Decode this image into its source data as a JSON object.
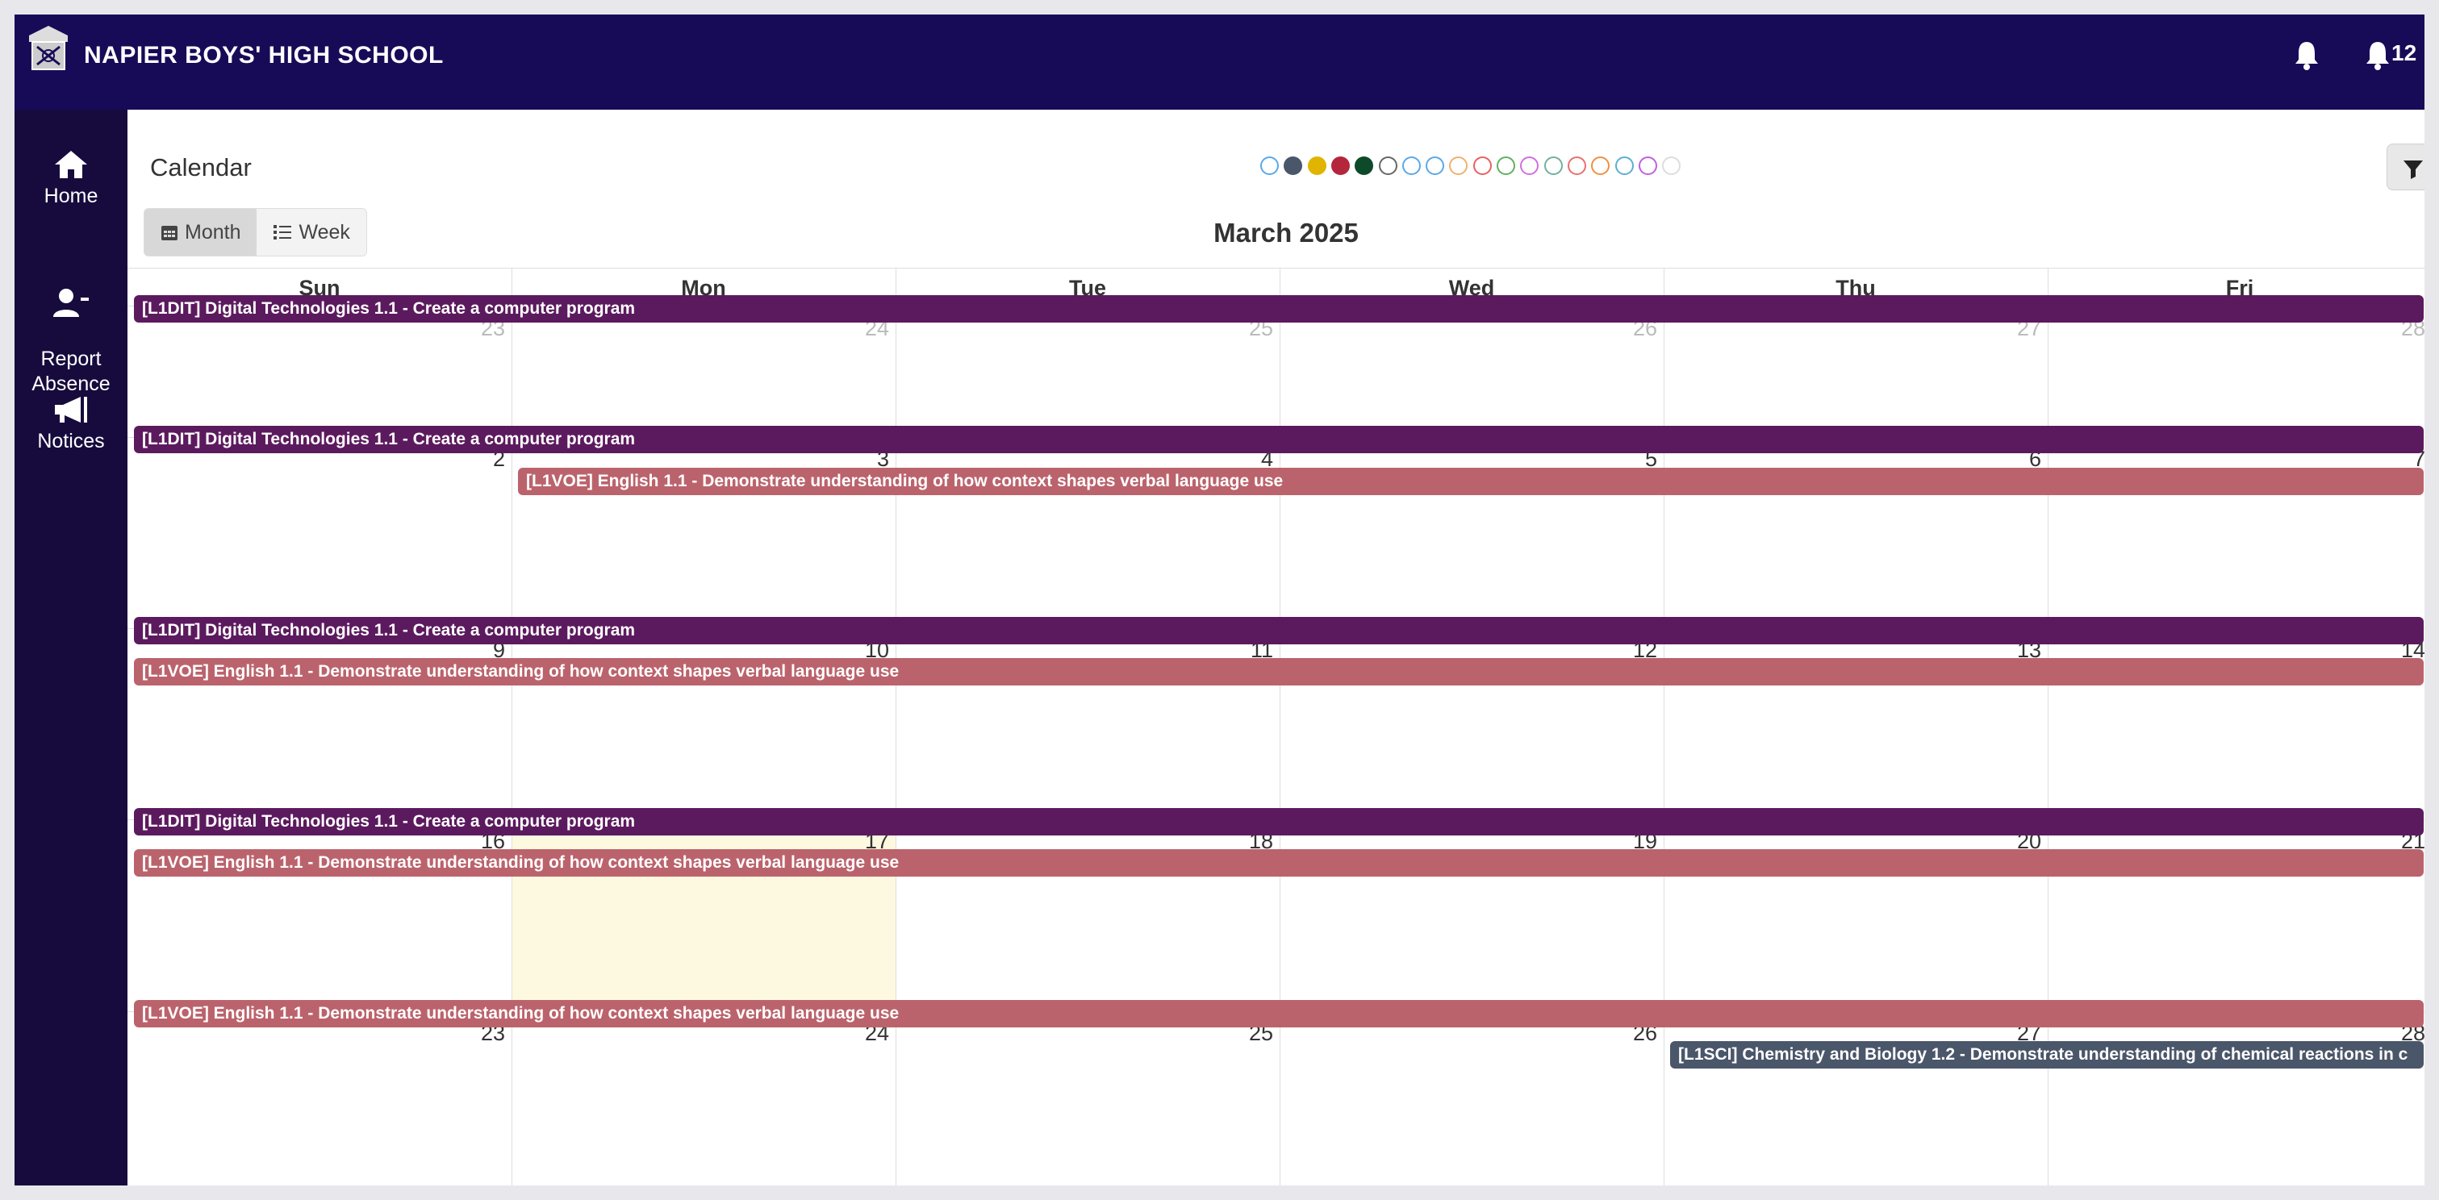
{
  "header": {
    "school_name": "NAPIER BOYS' HIGH SCHOOL",
    "notification_count": "12",
    "bg_color": "#170b58"
  },
  "sidebar": {
    "items": [
      {
        "label": "Home",
        "icon": "home-icon"
      },
      {
        "label": "Report\nAbsence",
        "icon": "report-absence-icon"
      },
      {
        "label": "Notices",
        "icon": "megaphone-icon"
      }
    ]
  },
  "calendar": {
    "title": "Calendar",
    "month_title": "March 2025",
    "views": [
      {
        "label": "Month",
        "active": true
      },
      {
        "label": "Week",
        "active": false
      }
    ],
    "day_headers": [
      "Sun",
      "Mon",
      "Tue",
      "Wed",
      "Thu",
      "Fri"
    ],
    "filter_dots": [
      "#5aa8e8",
      "#4a5669",
      "#e0b400",
      "#b3263c",
      "#0d4a2a",
      "#666666",
      "#5aa8e8",
      "#5aa8e8",
      "#f0b070",
      "#e86060",
      "#60b060",
      "#d070e0",
      "#70b0a0",
      "#e87070",
      "#f09040",
      "#5ab0d0",
      "#c060e0",
      "#dddddd"
    ],
    "weeks": [
      {
        "days": [
          "23",
          "24",
          "25",
          "26",
          "27",
          "28"
        ],
        "dim": true
      },
      {
        "days": [
          "2",
          "3",
          "4",
          "5",
          "6",
          "7"
        ]
      },
      {
        "days": [
          "9",
          "10",
          "11",
          "12",
          "13",
          "14"
        ]
      },
      {
        "days": [
          "16",
          "17",
          "18",
          "19",
          "20",
          "21"
        ]
      },
      {
        "days": [
          "23",
          "24",
          "25",
          "26",
          "27",
          "28"
        ]
      }
    ],
    "today": "17",
    "events": {
      "dit": "[L1DIT] Digital Technologies 1.1 - Create a computer program",
      "voe": "[L1VOE] English 1.1 - Demonstrate understanding of how context shapes verbal language use",
      "sci": "[L1SCI] Chemistry and Biology 1.2 - Demonstrate understanding of chemical reactions in c"
    },
    "event_colors": {
      "dit": "#5c1a5e",
      "voe": "#bb636c",
      "sci": "#4a5669"
    }
  }
}
